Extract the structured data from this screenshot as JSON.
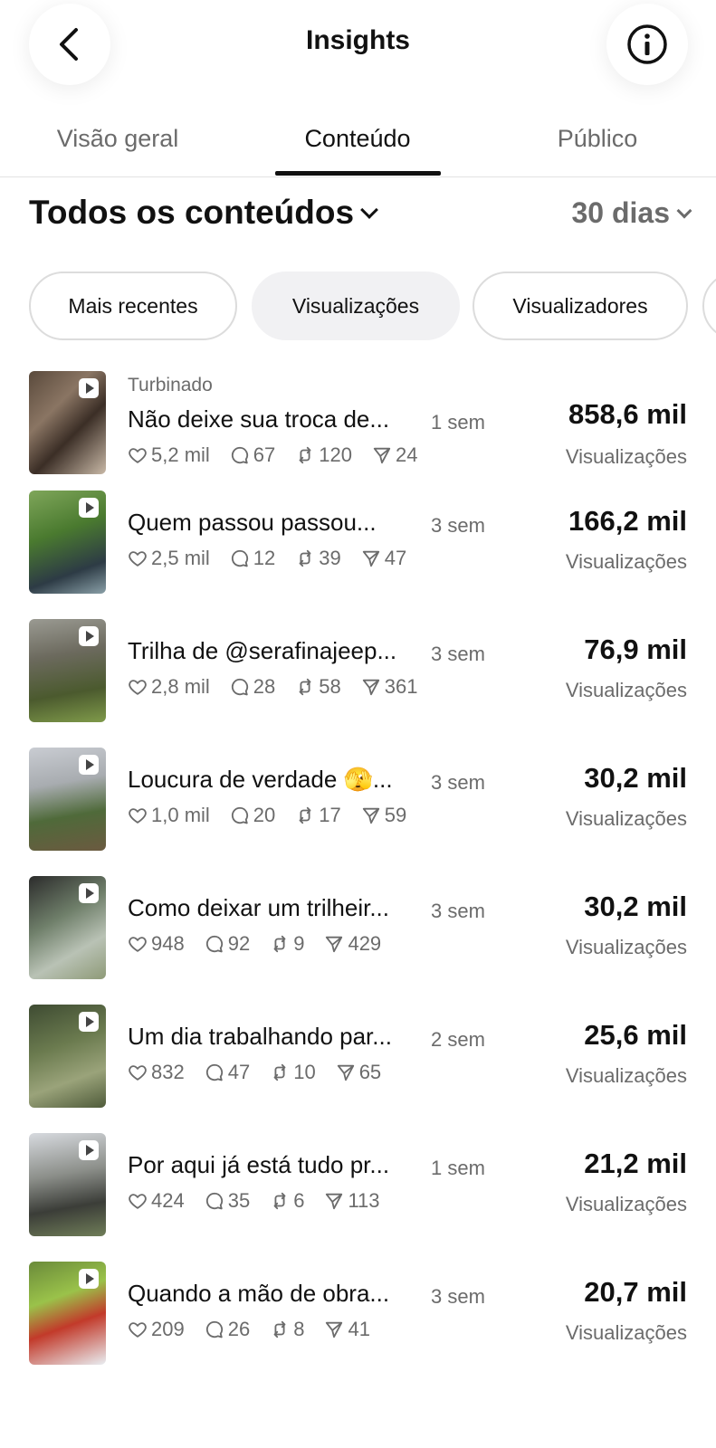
{
  "header": {
    "title": "Insights"
  },
  "tabs": [
    {
      "label": "Visão geral"
    },
    {
      "label": "Conteúdo"
    },
    {
      "label": "Público"
    }
  ],
  "filter": {
    "title": "Todos os conteúdos",
    "range": "30 dias"
  },
  "sort_chips": [
    {
      "label": "Mais recentes"
    },
    {
      "label": "Visualizações"
    },
    {
      "label": "Visualizadores"
    }
  ],
  "posts": [
    {
      "badge": "Turbinado",
      "caption": "Não deixe sua troca de...",
      "age": "1 sem",
      "likes": "5,2 mil",
      "comments": "67",
      "shares": "120",
      "sends": "24",
      "views": "858,6 mil",
      "views_label": "Visualizações"
    },
    {
      "caption": "Quem passou passou...",
      "age": "3 sem",
      "likes": "2,5 mil",
      "comments": "12",
      "shares": "39",
      "sends": "47",
      "views": "166,2 mil",
      "views_label": "Visualizações"
    },
    {
      "caption": "Trilha de @serafinajeep...",
      "age": "3 sem",
      "likes": "2,8 mil",
      "comments": "28",
      "shares": "58",
      "sends": "361",
      "views": "76,9 mil",
      "views_label": "Visualizações"
    },
    {
      "caption": "Loucura de verdade 🫣...",
      "age": "3 sem",
      "likes": "1,0 mil",
      "comments": "20",
      "shares": "17",
      "sends": "59",
      "views": "30,2 mil",
      "views_label": "Visualizações"
    },
    {
      "caption": "Como deixar um trilheir...",
      "age": "3 sem",
      "likes": "948",
      "comments": "92",
      "shares": "9",
      "sends": "429",
      "views": "30,2 mil",
      "views_label": "Visualizações"
    },
    {
      "caption": "Um dia trabalhando par...",
      "age": "2 sem",
      "likes": "832",
      "comments": "47",
      "shares": "10",
      "sends": "65",
      "views": "25,6 mil",
      "views_label": "Visualizações"
    },
    {
      "caption": "Por aqui já está tudo pr...",
      "age": "1 sem",
      "likes": "424",
      "comments": "35",
      "shares": "6",
      "sends": "113",
      "views": "21,2 mil",
      "views_label": "Visualizações"
    },
    {
      "caption": "Quando a mão de obra...",
      "age": "3 sem",
      "likes": "209",
      "comments": "26",
      "shares": "8",
      "sends": "41",
      "views": "20,7 mil",
      "views_label": "Visualizações"
    }
  ],
  "icons": {
    "back": "chevron-left-icon",
    "info": "info-icon",
    "like": "heart-icon",
    "comment": "comment-icon",
    "share": "repost-icon",
    "send": "send-icon",
    "play": "play-icon"
  }
}
